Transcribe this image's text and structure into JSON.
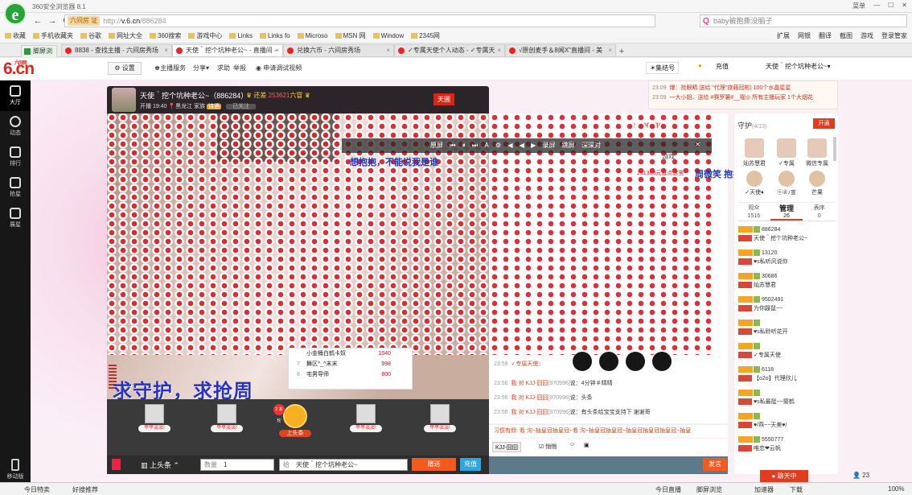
{
  "browser": {
    "title": "360安全浏览器 8.1",
    "title_right": [
      "菜单"
    ],
    "url_tag": "六间房 证",
    "url_prefix": "http://",
    "url_host": "v.6.cn",
    "url_path": "/886284",
    "search_placeholder": "baby被抱撕没脑子",
    "bookmarks": [
      "收藏",
      "手机收藏夹",
      "谷歌",
      "网址大全",
      "360搜索",
      "游戏中心",
      "Links",
      "Links fo",
      "Microso",
      "MSN 网",
      "Window",
      "2345网"
    ],
    "bookmarks_right": [
      "扩展",
      "网银",
      "翻译",
      "截图",
      "游戏",
      "登录管家"
    ],
    "first_tab": "脚屏浏览",
    "tabs": [
      "8838 - 查找主播 - 六间房秀场",
      "天使＾挖个坑种老公~ - 直播间 - ",
      "兑换六币 - 六间房秀场",
      "✓专属天使个人动态 - ✓专属天",
      "√原创麦手＆8闻X\"直播间 - 美"
    ]
  },
  "site": {
    "logo": "6.cn",
    "logo_small": "六间房",
    "settings": "设置",
    "anchor_service": "主播服务",
    "share": "分享",
    "help": "求助",
    "report": "举报",
    "apply_video": "申请调试视频",
    "collect": "集结号",
    "recharge": "充值",
    "user_name": "天使＾挖个坑种老公~"
  },
  "ticker": [
    {
      "time": "23:09",
      "text": "爆：抢眼睛 送给 \"代理\"旅藉冠彬) 100个水晶星星"
    },
    {
      "time": "23:09",
      "text": "一大小姐、送给 #赛罗薯#__喔◎ 所有主播玩家 1个大烟花"
    }
  ],
  "leftnav": [
    {
      "label": "大厅",
      "icon": "tv-icon"
    },
    {
      "label": "动态",
      "icon": "compass-icon"
    },
    {
      "label": "排行",
      "icon": "trophy-icon"
    },
    {
      "label": "抢星",
      "icon": "star-icon"
    },
    {
      "label": "展星",
      "icon": "shop-icon"
    }
  ],
  "leftnav_mobile": "移动版",
  "room": {
    "title": "天使＾挖个坑种老公~（886284）",
    "start_time": "开播 19:40",
    "location": "黑龙江",
    "family": "家族",
    "family_tag": "诗酒",
    "follow": "已关注",
    "badge_label": "还差",
    "badge_num": "253621",
    "badge_tail": "六冒",
    "tianlang": "天圃"
  },
  "rank_popup": [
    {
      "n": "",
      "name": "小金桶白鹤卡奴",
      "score": "1040"
    },
    {
      "n": "7",
      "name": "舞区^_^末末",
      "score": "998"
    },
    {
      "n": "8",
      "name": "宅男导师",
      "score": "800"
    }
  ],
  "big_banner": "求守护，求抢周",
  "player": {
    "controls": [
      "原屏",
      "⏮",
      "⏸",
      "⏭",
      "A",
      "⚙",
      "◀",
      "◀",
      "▶",
      "录屏",
      "跳屏",
      "深深对"
    ],
    "game_label": "游戏",
    "promo1": "想抱抱，不能说我是谁",
    "promo2": "周微笑 抱抱哥挂下来",
    "promo_small": "261388元直点这里",
    "rank_head": "106180"
  },
  "gifts": [
    {
      "label": "平平淡淡!"
    },
    {
      "label": "平平淡淡!"
    },
    {
      "label": "上头条"
    },
    {
      "label": "平平淡淡!"
    },
    {
      "label": "平平淡淡!"
    }
  ],
  "gift_badge": "2 本轮",
  "sendbar": {
    "headline": "上头条",
    "qty_label": "数量",
    "qty": "1",
    "to_label": "给",
    "to": "天使＾挖个坑种老公~",
    "gift_btn": "赠送",
    "charge_btn": "充值"
  },
  "chat": [
    {
      "time": "23:59",
      "who": "",
      "id": "",
      "msg": "✓专属天使："
    },
    {
      "time": "23:56",
      "who": "我 对 KJJ-囧囧",
      "id": "[970996]",
      "msg": "说：4分钟＃晴晴"
    },
    {
      "time": "23:56",
      "who": "我 对 KJJ-囧囧",
      "id": "[970996]",
      "msg": "说：头条"
    },
    {
      "time": "23:56",
      "who": "我 对 KJJ-囧囧",
      "id": "[970996]",
      "msg": "说：有头条给宝宝支持下 谢谢哥"
    }
  ],
  "chat_system": "习惯有频: 看 沟~抽皇冠抽皇冠~看 沟~抽皇冠抽皇冠~抽皇冠抽皇冠抽皇冠~抽皇",
  "chat_input": {
    "target": "KJJ-囧囧",
    "private": "悄悄",
    "send": "发言"
  },
  "right": {
    "guard_title": "守护",
    "guard_count": "(4/13)",
    "open": "开通",
    "guards": [
      "灿苏慧君",
      "✓专属",
      "微信专属"
    ],
    "guards2": [
      "✓天使♦",
      "ⓔ②♪宣",
      "芒果"
    ],
    "tabs": [
      {
        "label": "观众",
        "count": "1516"
      },
      {
        "label": "管理",
        "count": "26"
      },
      {
        "label": "表序",
        "count": "0"
      }
    ],
    "users": [
      {
        "uid": "886284",
        "nick": "天使＾挖个坑种老公~"
      },
      {
        "uid": "13120",
        "nick": "♥s私听风说你"
      },
      {
        "uid": "30686",
        "nick": "灿苏慧君"
      },
      {
        "uid": "9502491",
        "nick": "为你鼹鼠~~"
      },
      {
        "uid": "",
        "nick": "♥s私聆听花开"
      },
      {
        "uid": "",
        "nick": "✓专属天使"
      },
      {
        "uid": "6118",
        "nick": "【o2o】代理欣儿"
      },
      {
        "uid": "",
        "nick": "♥s私最挺~~婴鹤"
      },
      {
        "uid": "",
        "nick": "♥/燕~~天美♥/"
      },
      {
        "uid": "5550777",
        "nick": "唯恋❤云帆"
      }
    ]
  },
  "status": {
    "left1": "今日特卖",
    "left2": "好搜推荐",
    "right": [
      "今日直播",
      "脚屏浏览",
      "加速器",
      "下载",
      "100%"
    ],
    "chat_float": "聊天中",
    "online": "23"
  },
  "colors": {
    "accent": "#e63a1d",
    "nav_bg": "#171717",
    "blue_text": "#2a31c8"
  }
}
